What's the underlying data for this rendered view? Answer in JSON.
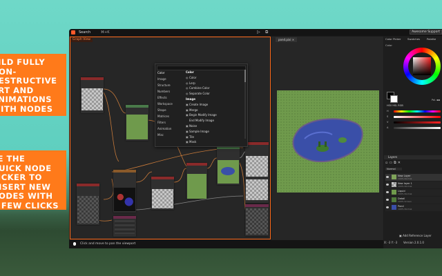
{
  "promo": {
    "left_1": "BUILD FULLY\nNON-\nDESTRUCTIVE\nART AND\nANIMATIONS\nWITH NODES",
    "left_2": "USE THE\nQUICK NODE\nPICKER TO\nINSERT NEW\nNODES WITH\nA FEW CLICKS"
  },
  "topbar": {
    "search": "Search",
    "hotkey": "⌘+K",
    "badge": "Awesome Support"
  },
  "graph": {
    "tab": "Graph View"
  },
  "picker": {
    "categories": [
      "Color",
      "Image",
      "Structure",
      "Numbers",
      "Effects",
      "Workspace",
      "Shape",
      "Matrices",
      "Filters",
      "Animation",
      "Misc"
    ],
    "groups": [
      {
        "title": "Color",
        "items": [
          "Color",
          "Lerp",
          "Combine Color",
          "Separate Color"
        ]
      },
      {
        "title": "Image",
        "items": [
          "Create Image",
          "Merge",
          "Begin Modify Image",
          "End Modify Image",
          "Noise",
          "Sample Image",
          "Tile",
          "Mask"
        ]
      }
    ]
  },
  "viewport": {
    "tab": "pond.pixi ×"
  },
  "status": {
    "hint": "Click and move to pan the viewport"
  },
  "right": {
    "tabs": [
      "Color Picker",
      "Swatches",
      "Palette"
    ],
    "color_label": "Color",
    "mode": "HSV  HSL  RGB",
    "palette_label": "Pal. ▪▪",
    "sliders": [
      "H",
      "S",
      "V",
      "A"
    ],
    "layers_title": "Layers",
    "blend": "Normal",
    "layers": [
      {
        "name": "New Layer",
        "sub": "100% Normal"
      },
      {
        "name": "New layer 1",
        "sub": "100% Normal"
      },
      {
        "name": "Liquid",
        "sub": "100% Normal"
      },
      {
        "name": "Detail",
        "sub": "100% Screen"
      },
      {
        "name": "Pond",
        "sub": "100% Normal"
      }
    ],
    "add_ref": "Add Reference Layer",
    "coords": "X: -3 Y: -3",
    "version": "Version 2.0.1.0"
  }
}
